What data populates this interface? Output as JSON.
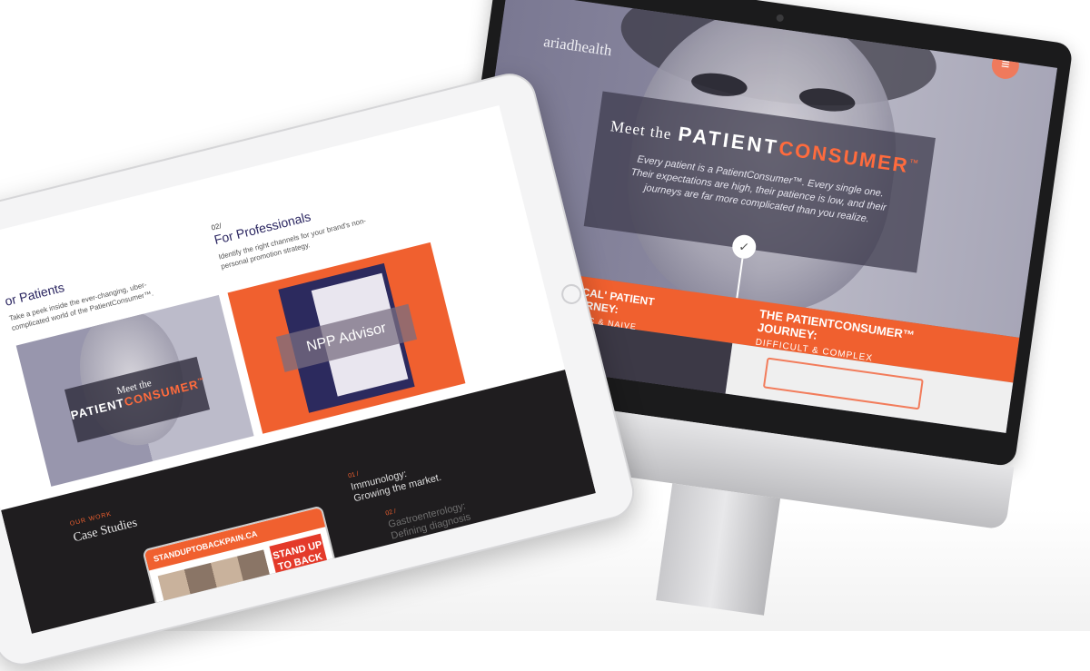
{
  "imac": {
    "brand": "ariadhealth",
    "menu_icon": "hamburger-icon",
    "hero": {
      "meet_lead": "Meet the",
      "title_part1": "PATIENT",
      "title_part2": "CONSUMER",
      "tm": "™",
      "intro": "Every patient is a PatientConsumer™. Every single one. Their expectations are high, their patience is low, and their journeys are far more complicated than you realize."
    },
    "journeys": {
      "typical_title": "THE 'TYPICAL' PATIENT JOURNEY:",
      "typical_sub": "SIMPLISTIC & NAIVE",
      "consumer_title": "THE PATIENTCONSUMER™ JOURNEY:",
      "consumer_sub": "DIFFICULT & COMPLEX"
    }
  },
  "ipad": {
    "patients": {
      "heading": "or Patients",
      "desc": "Take a peek inside the ever-changing, uber-complicated world of the PatientConsumer™.",
      "card_lead": "Meet the",
      "card_title1": "PATIENT",
      "card_title2": "CONSUMER",
      "card_tm": "™"
    },
    "professionals": {
      "number": "02/",
      "heading": "For Professionals",
      "desc": "Identify the right channels for your brand's non-personal promotion strategy.",
      "card_label": "NPP Advisor"
    },
    "case_studies": {
      "label": "OUR WORK",
      "title": "Case Studies",
      "tablet_banner": "STANDUPTOBACKPAIN.CA",
      "tablet_headline": "STAND UP TO BACK PAIN.",
      "items": [
        {
          "num": "01 /",
          "text1": "Immunology:",
          "text2": "Growing the market."
        },
        {
          "num": "02 /",
          "text1": "Gastroenterology:",
          "text2": "Defining diagnosis"
        }
      ]
    }
  },
  "colors": {
    "accent": "#f0602f",
    "navy": "#2a2560",
    "dark": "#1f1d1f"
  }
}
